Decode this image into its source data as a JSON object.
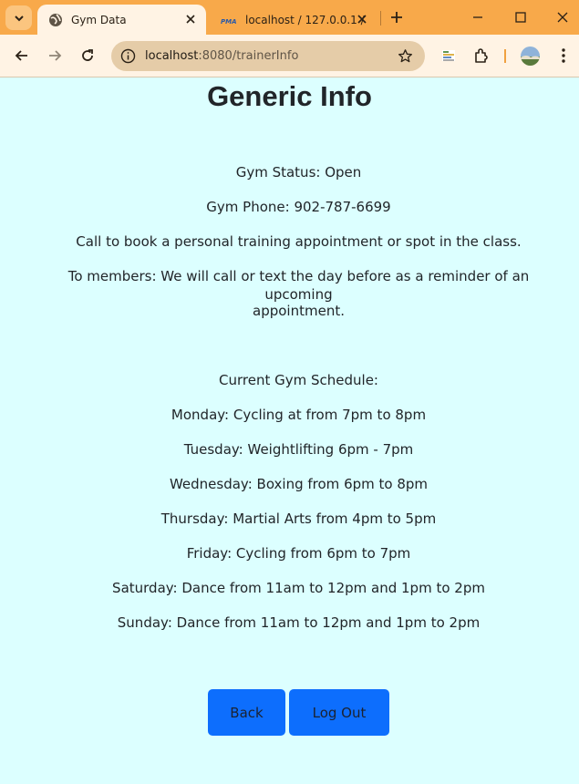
{
  "browser": {
    "tabs": [
      {
        "title": "Gym Data",
        "active": true,
        "icon": "globe-icon"
      },
      {
        "title": "localhost / 127.0.0.1 /",
        "active": false,
        "icon": "phpmyadmin-icon"
      }
    ],
    "url_host": "localhost",
    "url_path": ":8080/trainerInfo",
    "colors": {
      "frame": "#f8a94a",
      "toolbar": "#fff3e4",
      "omnibox": "#e5cca8"
    }
  },
  "page": {
    "title": "Generic Info",
    "status": "Gym Status: Open",
    "phone": "Gym Phone: 902-787-6699",
    "booking": "Call to book a personal training appointment or spot in the class.",
    "reminder_line1": "To members: We will call or text the day before as a reminder of an upcoming",
    "reminder_line2": "appointment.",
    "schedule_heading": "Current Gym Schedule:",
    "schedule": [
      "Monday: Cycling at from 7pm to 8pm",
      "Tuesday: Weightlifting 6pm - 7pm",
      "Wednesday: Boxing from 6pm to 8pm",
      "Thursday: Martial Arts from 4pm to 5pm",
      "Friday: Cycling from 6pm to 7pm",
      "Saturday: Dance from 11am to 12pm and 1pm to 2pm",
      "Sunday: Dance from 11am to 12pm and 1pm to 2pm"
    ],
    "buttons": {
      "back": "Back",
      "logout": "Log Out"
    },
    "colors": {
      "background": "#dcffff",
      "button": "#0d6efd"
    }
  }
}
